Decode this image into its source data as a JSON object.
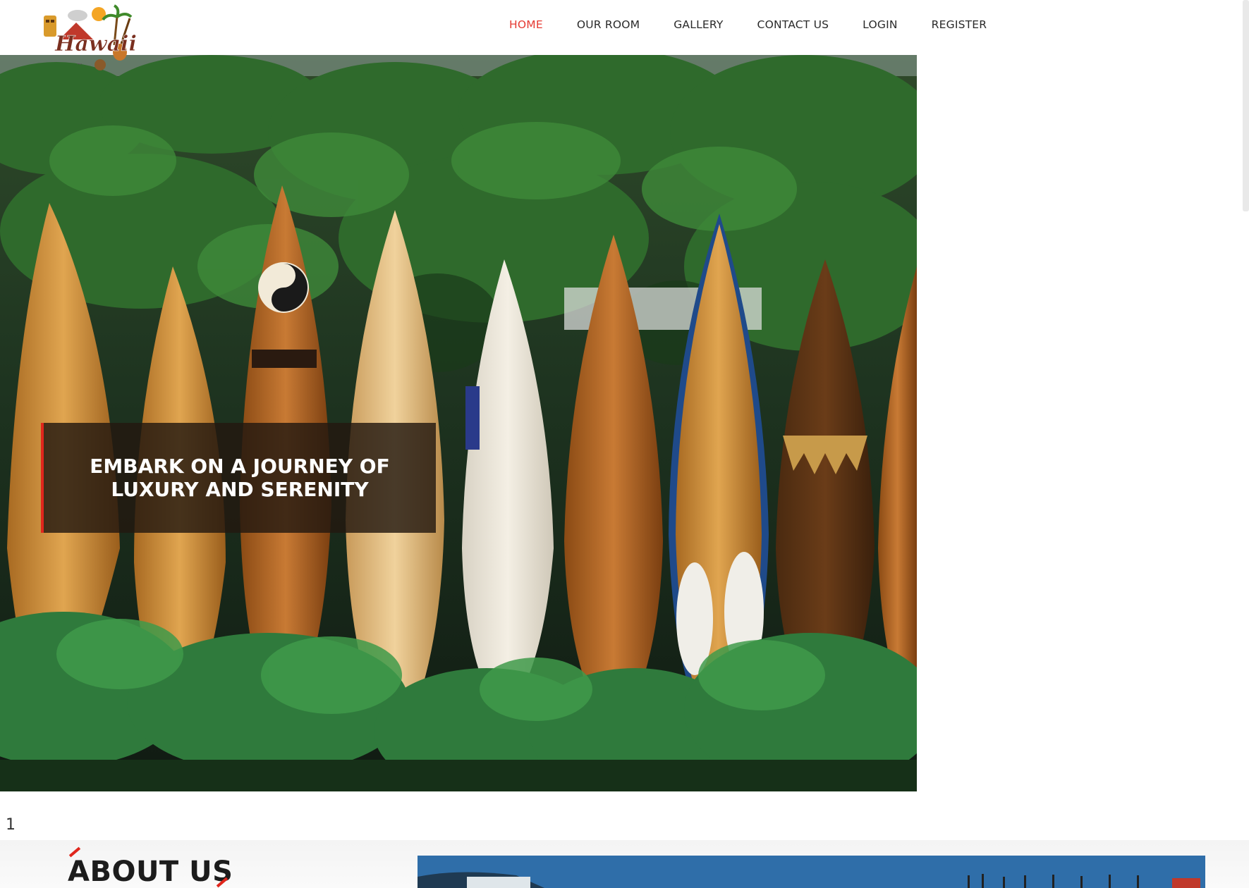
{
  "header": {
    "logo_text": "Hawaii",
    "nav": [
      {
        "label": "HOME",
        "active": true
      },
      {
        "label": "OUR ROOM",
        "active": false
      },
      {
        "label": "GALLERY",
        "active": false
      },
      {
        "label": "CONTACT US",
        "active": false
      },
      {
        "label": "LOGIN",
        "active": false
      },
      {
        "label": "REGISTER",
        "active": false
      }
    ]
  },
  "hero": {
    "caption_line1": "EMBARK ON A JOURNEY OF",
    "caption_line2": "LUXURY AND SERENITY",
    "slides": 3,
    "active_slide": 3
  },
  "page_number": "1",
  "about": {
    "title": "ABOUT US"
  },
  "colors": {
    "accent": "#e53a32",
    "nav_text": "#2a2a2a",
    "caption_bg": "#231810"
  }
}
